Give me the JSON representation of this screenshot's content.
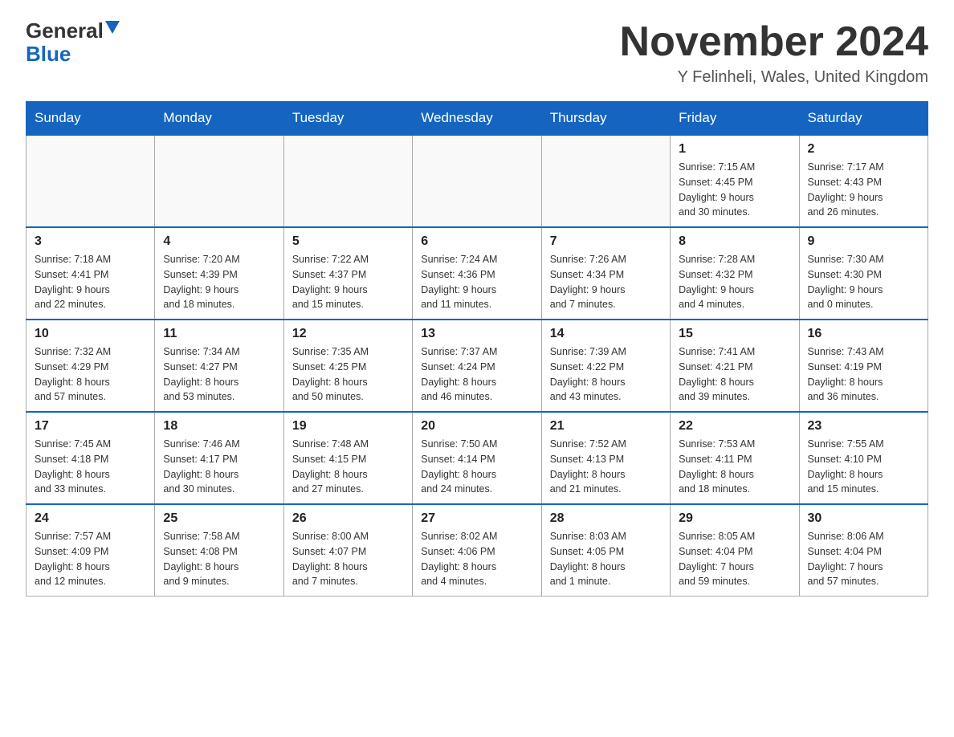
{
  "header": {
    "logo_general": "General",
    "logo_blue": "Blue",
    "month_title": "November 2024",
    "location": "Y Felinheli, Wales, United Kingdom"
  },
  "weekdays": [
    "Sunday",
    "Monday",
    "Tuesday",
    "Wednesday",
    "Thursday",
    "Friday",
    "Saturday"
  ],
  "weeks": [
    [
      {
        "day": "",
        "info": ""
      },
      {
        "day": "",
        "info": ""
      },
      {
        "day": "",
        "info": ""
      },
      {
        "day": "",
        "info": ""
      },
      {
        "day": "",
        "info": ""
      },
      {
        "day": "1",
        "info": "Sunrise: 7:15 AM\nSunset: 4:45 PM\nDaylight: 9 hours\nand 30 minutes."
      },
      {
        "day": "2",
        "info": "Sunrise: 7:17 AM\nSunset: 4:43 PM\nDaylight: 9 hours\nand 26 minutes."
      }
    ],
    [
      {
        "day": "3",
        "info": "Sunrise: 7:18 AM\nSunset: 4:41 PM\nDaylight: 9 hours\nand 22 minutes."
      },
      {
        "day": "4",
        "info": "Sunrise: 7:20 AM\nSunset: 4:39 PM\nDaylight: 9 hours\nand 18 minutes."
      },
      {
        "day": "5",
        "info": "Sunrise: 7:22 AM\nSunset: 4:37 PM\nDaylight: 9 hours\nand 15 minutes."
      },
      {
        "day": "6",
        "info": "Sunrise: 7:24 AM\nSunset: 4:36 PM\nDaylight: 9 hours\nand 11 minutes."
      },
      {
        "day": "7",
        "info": "Sunrise: 7:26 AM\nSunset: 4:34 PM\nDaylight: 9 hours\nand 7 minutes."
      },
      {
        "day": "8",
        "info": "Sunrise: 7:28 AM\nSunset: 4:32 PM\nDaylight: 9 hours\nand 4 minutes."
      },
      {
        "day": "9",
        "info": "Sunrise: 7:30 AM\nSunset: 4:30 PM\nDaylight: 9 hours\nand 0 minutes."
      }
    ],
    [
      {
        "day": "10",
        "info": "Sunrise: 7:32 AM\nSunset: 4:29 PM\nDaylight: 8 hours\nand 57 minutes."
      },
      {
        "day": "11",
        "info": "Sunrise: 7:34 AM\nSunset: 4:27 PM\nDaylight: 8 hours\nand 53 minutes."
      },
      {
        "day": "12",
        "info": "Sunrise: 7:35 AM\nSunset: 4:25 PM\nDaylight: 8 hours\nand 50 minutes."
      },
      {
        "day": "13",
        "info": "Sunrise: 7:37 AM\nSunset: 4:24 PM\nDaylight: 8 hours\nand 46 minutes."
      },
      {
        "day": "14",
        "info": "Sunrise: 7:39 AM\nSunset: 4:22 PM\nDaylight: 8 hours\nand 43 minutes."
      },
      {
        "day": "15",
        "info": "Sunrise: 7:41 AM\nSunset: 4:21 PM\nDaylight: 8 hours\nand 39 minutes."
      },
      {
        "day": "16",
        "info": "Sunrise: 7:43 AM\nSunset: 4:19 PM\nDaylight: 8 hours\nand 36 minutes."
      }
    ],
    [
      {
        "day": "17",
        "info": "Sunrise: 7:45 AM\nSunset: 4:18 PM\nDaylight: 8 hours\nand 33 minutes."
      },
      {
        "day": "18",
        "info": "Sunrise: 7:46 AM\nSunset: 4:17 PM\nDaylight: 8 hours\nand 30 minutes."
      },
      {
        "day": "19",
        "info": "Sunrise: 7:48 AM\nSunset: 4:15 PM\nDaylight: 8 hours\nand 27 minutes."
      },
      {
        "day": "20",
        "info": "Sunrise: 7:50 AM\nSunset: 4:14 PM\nDaylight: 8 hours\nand 24 minutes."
      },
      {
        "day": "21",
        "info": "Sunrise: 7:52 AM\nSunset: 4:13 PM\nDaylight: 8 hours\nand 21 minutes."
      },
      {
        "day": "22",
        "info": "Sunrise: 7:53 AM\nSunset: 4:11 PM\nDaylight: 8 hours\nand 18 minutes."
      },
      {
        "day": "23",
        "info": "Sunrise: 7:55 AM\nSunset: 4:10 PM\nDaylight: 8 hours\nand 15 minutes."
      }
    ],
    [
      {
        "day": "24",
        "info": "Sunrise: 7:57 AM\nSunset: 4:09 PM\nDaylight: 8 hours\nand 12 minutes."
      },
      {
        "day": "25",
        "info": "Sunrise: 7:58 AM\nSunset: 4:08 PM\nDaylight: 8 hours\nand 9 minutes."
      },
      {
        "day": "26",
        "info": "Sunrise: 8:00 AM\nSunset: 4:07 PM\nDaylight: 8 hours\nand 7 minutes."
      },
      {
        "day": "27",
        "info": "Sunrise: 8:02 AM\nSunset: 4:06 PM\nDaylight: 8 hours\nand 4 minutes."
      },
      {
        "day": "28",
        "info": "Sunrise: 8:03 AM\nSunset: 4:05 PM\nDaylight: 8 hours\nand 1 minute."
      },
      {
        "day": "29",
        "info": "Sunrise: 8:05 AM\nSunset: 4:04 PM\nDaylight: 7 hours\nand 59 minutes."
      },
      {
        "day": "30",
        "info": "Sunrise: 8:06 AM\nSunset: 4:04 PM\nDaylight: 7 hours\nand 57 minutes."
      }
    ]
  ]
}
